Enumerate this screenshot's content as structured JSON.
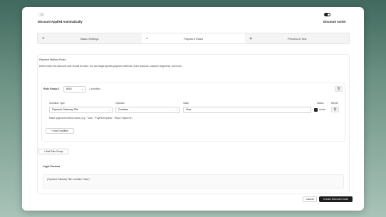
{
  "header": {
    "left_label": "Discount Applied Automatically",
    "right_label": "Discount Active"
  },
  "tabs": [
    {
      "label": "Basic Settings",
      "icon": "gear-icon"
    },
    {
      "label": "Payment Rules",
      "icon": "card-icon"
    },
    {
      "label": "Preview & Test",
      "icon": "eye-icon"
    }
  ],
  "rules": {
    "section_title": "Payment Method Rules",
    "description": "Define when this discount code should be valid. You can target specific payment methods, order amounts, customer segments, and more.",
    "group": {
      "label": "Rule Group 1",
      "logic_operator": "AND",
      "condition_count": "1 condition",
      "columns": {
        "condition_type": "Condition Type",
        "operator": "Operator",
        "value": "Value",
        "status": "Status",
        "delete": "Delete"
      },
      "condition": {
        "type": "Payment Gateway Title",
        "operator": "Contains",
        "value": "Visa",
        "status": "Active",
        "hint": "Match payment method name (e.g., \"Visa\", \"PayPal Express\", \"Stripe Payment\")"
      },
      "add_condition": "+ Add Condition"
    },
    "add_rule_group": "+ Add Rule Group",
    "logic_preview_title": "Logic Preview",
    "logic_preview_text": "(Payment Gateway Title Contains \"Visa\")"
  },
  "footer": {
    "cancel": "Cancel",
    "create": "Create Discount Code"
  },
  "colors": {
    "primary": "#1d1d1f",
    "background_top": "#41695d",
    "background_bottom": "#a9c3b8"
  }
}
